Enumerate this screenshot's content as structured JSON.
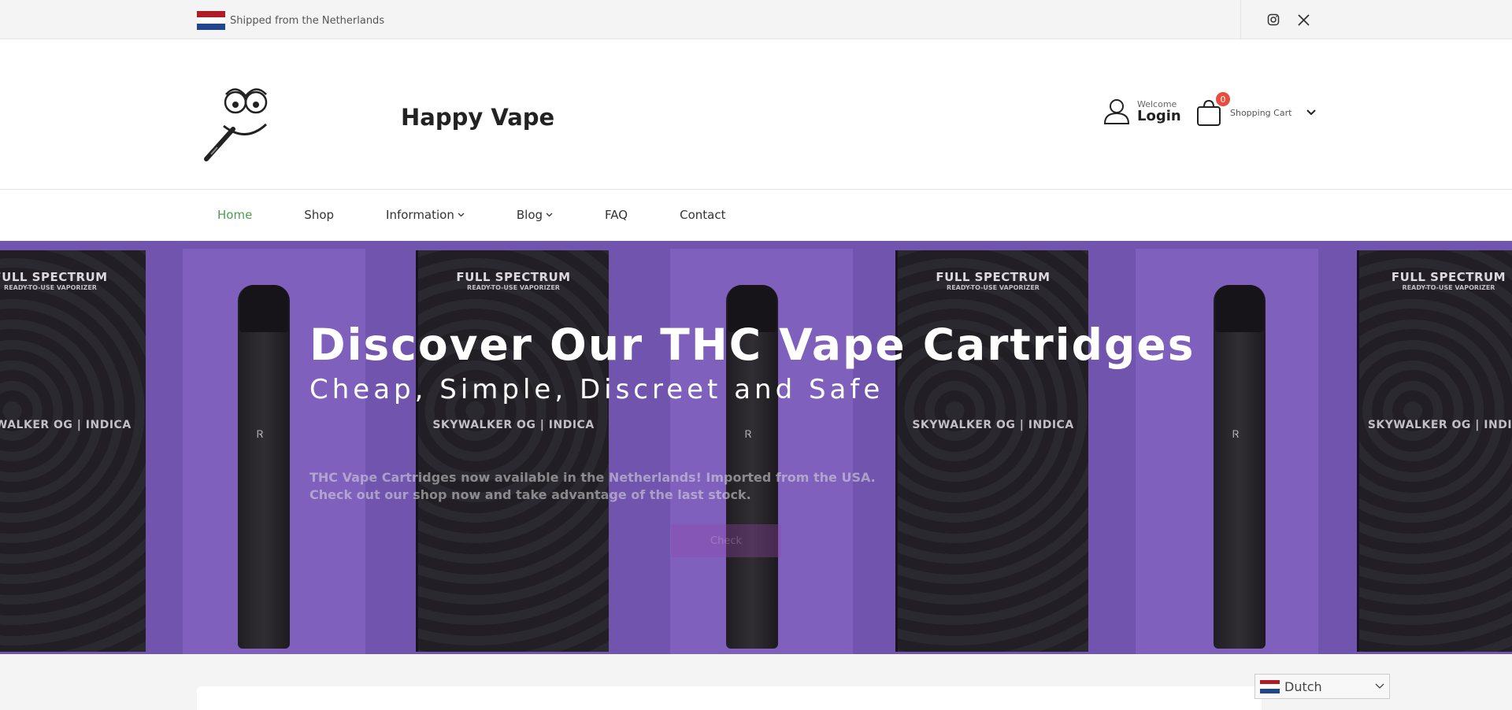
{
  "topbar": {
    "ship_text": "Shipped from the Netherlands",
    "flag_colors": [
      "#ae1c28",
      "#ffffff",
      "#21468b"
    ],
    "social": [
      {
        "icon": "instagram-icon"
      },
      {
        "icon": "x-twitter-icon"
      }
    ]
  },
  "header": {
    "brand": "Happy Vape",
    "login_small": "Welcome",
    "login_big": "Login",
    "cart_count": "0",
    "cart_label": "Shopping Cart"
  },
  "nav": {
    "items": [
      {
        "label": "Home",
        "active": true
      },
      {
        "label": "Shop"
      },
      {
        "label": "Information",
        "dropdown": true
      },
      {
        "label": "Blog",
        "dropdown": true
      },
      {
        "label": "FAQ"
      },
      {
        "label": "Contact"
      }
    ]
  },
  "hero": {
    "title": "Discover Our THC Vape Cartridges",
    "subtitle": "Cheap, Simple, Discreet and Safe",
    "text_line1": "THC Vape Cartridges now available in the Netherlands! Imported from the USA.",
    "text_line2": "Check out our shop now and take advantage of the last stock.",
    "cta": "Check",
    "box_title": "FULL SPECTRUM",
    "box_subtitle": "READY-TO-USE VAPORIZER",
    "box_strain": "SKYWALKER OG | INDICA",
    "accent": "#7d5cc4"
  },
  "language": {
    "selected": "Dutch"
  },
  "colors": {
    "nav_active": "#4a9f4f",
    "badge": "#e74c3c"
  }
}
